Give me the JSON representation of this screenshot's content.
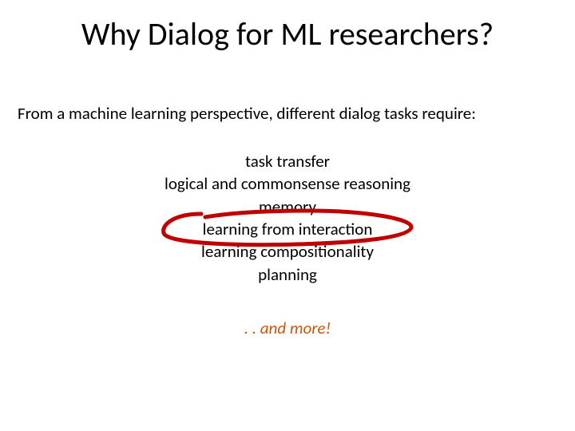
{
  "title": "Why Dialog for ML researchers?",
  "subtitle": "From a machine learning perspective, different dialog tasks require:",
  "items": [
    "task transfer",
    "logical and commonsense reasoning",
    "memory",
    "learning from interaction",
    "learning compositionality",
    "planning"
  ],
  "footer": ". . and more!",
  "colors": {
    "accent": "#c55a11",
    "annotation": "#c00000"
  }
}
